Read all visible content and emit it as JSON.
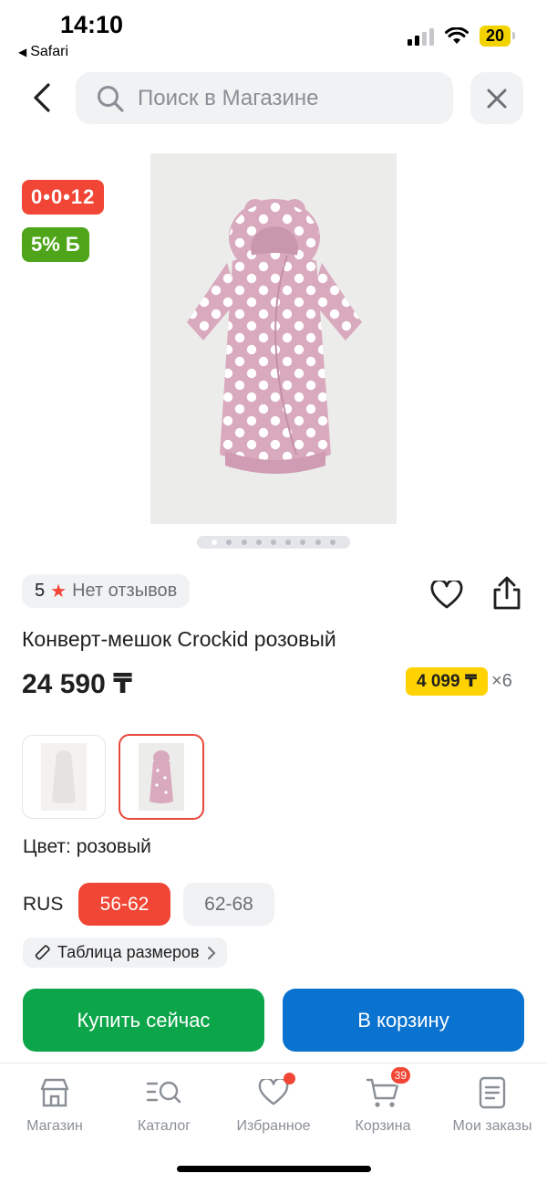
{
  "status_bar": {
    "time": "14:10",
    "back_app": "Safari",
    "battery": "20"
  },
  "search": {
    "placeholder": "Поиск в Магазине"
  },
  "product": {
    "timer_badge": "0•0•12",
    "bonus_badge": "5% Б",
    "image_count": 9,
    "active_image": 1,
    "rating": "5",
    "reviews_text": "Нет отзывов",
    "title": "Конверт-мешок Crockid розовый",
    "price": "24 590 ₸",
    "installment_amount": "4 099 ₸",
    "installment_times": "×6",
    "color_label": "Цвет: розовый",
    "size_system": "RUS",
    "sizes": [
      {
        "label": "56-62",
        "selected": true
      },
      {
        "label": "62-68",
        "selected": false
      }
    ],
    "size_table_label": "Таблица размеров",
    "buy_now_label": "Купить сейчас",
    "to_cart_label": "В корзину",
    "accent_color": "#f14635",
    "buy_color": "#0ca54a",
    "cart_color": "#0a73cf"
  },
  "tabbar": {
    "items": [
      {
        "label": "Магазин",
        "icon": "store-icon"
      },
      {
        "label": "Каталог",
        "icon": "catalog-search-icon"
      },
      {
        "label": "Избранное",
        "icon": "heart-icon"
      },
      {
        "label": "Корзина",
        "icon": "cart-icon",
        "badge": "39"
      },
      {
        "label": "Мои заказы",
        "icon": "orders-icon"
      }
    ]
  }
}
